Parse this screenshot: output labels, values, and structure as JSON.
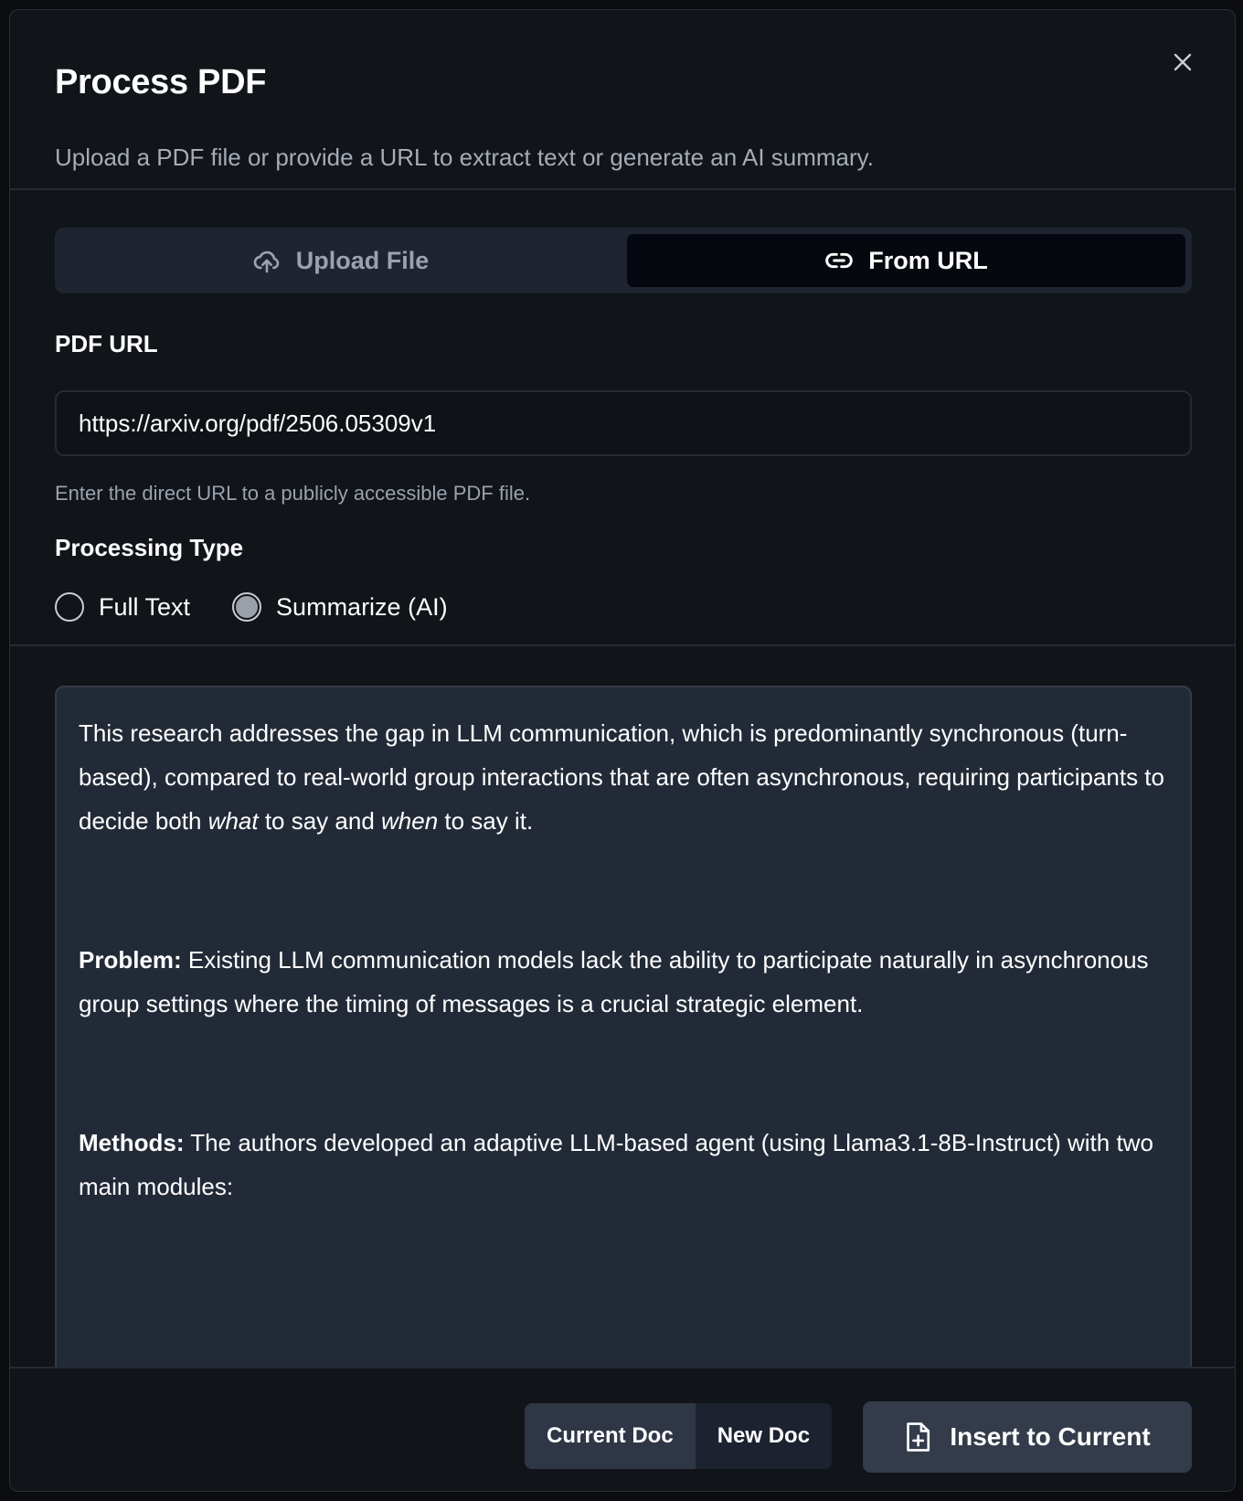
{
  "dialog": {
    "title": "Process PDF",
    "subtitle": "Upload a PDF file or provide a URL to extract text or generate an AI summary.",
    "close_icon": "close-icon"
  },
  "tabs": [
    {
      "label": "Upload File",
      "icon": "upload-cloud-icon",
      "active": false
    },
    {
      "label": "From URL",
      "icon": "link-icon",
      "active": true
    }
  ],
  "url_field": {
    "label": "PDF URL",
    "value": "https://arxiv.org/pdf/2506.05309v1",
    "hint": "Enter the direct URL to a publicly accessible PDF file."
  },
  "processing": {
    "label": "Processing Type",
    "options": [
      {
        "label": "Full Text",
        "selected": false
      },
      {
        "label": "Summarize (AI)",
        "selected": true
      }
    ]
  },
  "result": {
    "intro_a": "This research addresses the gap in LLM communication, which is predominantly synchronous (turn-based), compared to real-world group interactions that are often asynchronous, requiring participants to decide both ",
    "intro_what": "what",
    "intro_b": " to say and ",
    "intro_when": "when",
    "intro_c": " to say it.",
    "problem_label": "Problem:",
    "problem_text": " Existing LLM communication models lack the ability to participate naturally in asynchronous group settings where the timing of messages is a crucial strategic element.",
    "methods_label": "Methods:",
    "methods_text": " The authors developed an adaptive LLM-based agent (using Llama3.1-8B-Instruct) with two main modules:"
  },
  "footer": {
    "segments": [
      {
        "label": "Current Doc",
        "active": true
      },
      {
        "label": "New Doc",
        "active": false
      }
    ],
    "insert_label": "Insert to Current",
    "insert_icon": "file-plus-icon"
  },
  "colors": {
    "dialog_bg": "#111418",
    "result_bg": "#232a37",
    "active_tab_bg": "#05080e",
    "primary_button_bg": "#343c4b"
  }
}
